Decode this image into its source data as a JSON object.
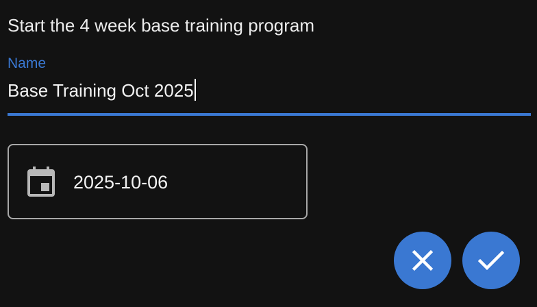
{
  "dialog": {
    "title": "Start the 4 week base training program"
  },
  "name_field": {
    "label": "Name",
    "value": "Base Training Oct 2025"
  },
  "date_field": {
    "value": "2025-10-06",
    "icon": "calendar-icon"
  },
  "actions": {
    "cancel_icon": "close-icon",
    "confirm_icon": "check-icon"
  },
  "colors": {
    "accent": "#3a78d2",
    "background": "#121212",
    "text": "#f2f2f2",
    "outline": "#a8a8a8"
  }
}
